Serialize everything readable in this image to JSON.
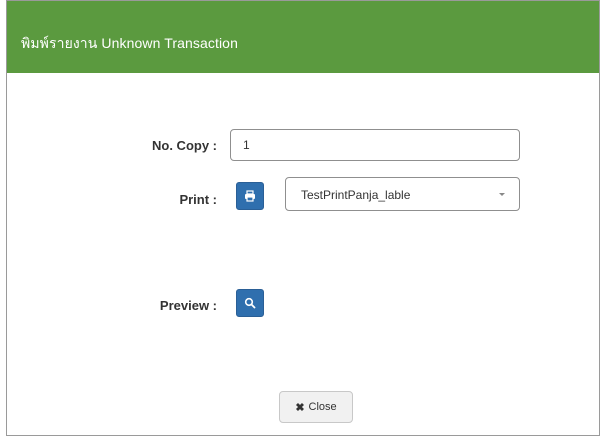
{
  "modal": {
    "title": "พิมพ์รายงาน Unknown Transaction",
    "header_color": "#5b9a3f"
  },
  "form": {
    "copy_label": "No. Copy :",
    "copy_value": "1",
    "print_label": "Print :",
    "print_icon": "printer-icon",
    "printer_selected": "TestPrintPanja_lable",
    "preview_label": "Preview :",
    "preview_icon": "search-icon",
    "button_color": "#2f6fae"
  },
  "footer": {
    "close_icon": "close-icon",
    "close_label": "Close"
  }
}
